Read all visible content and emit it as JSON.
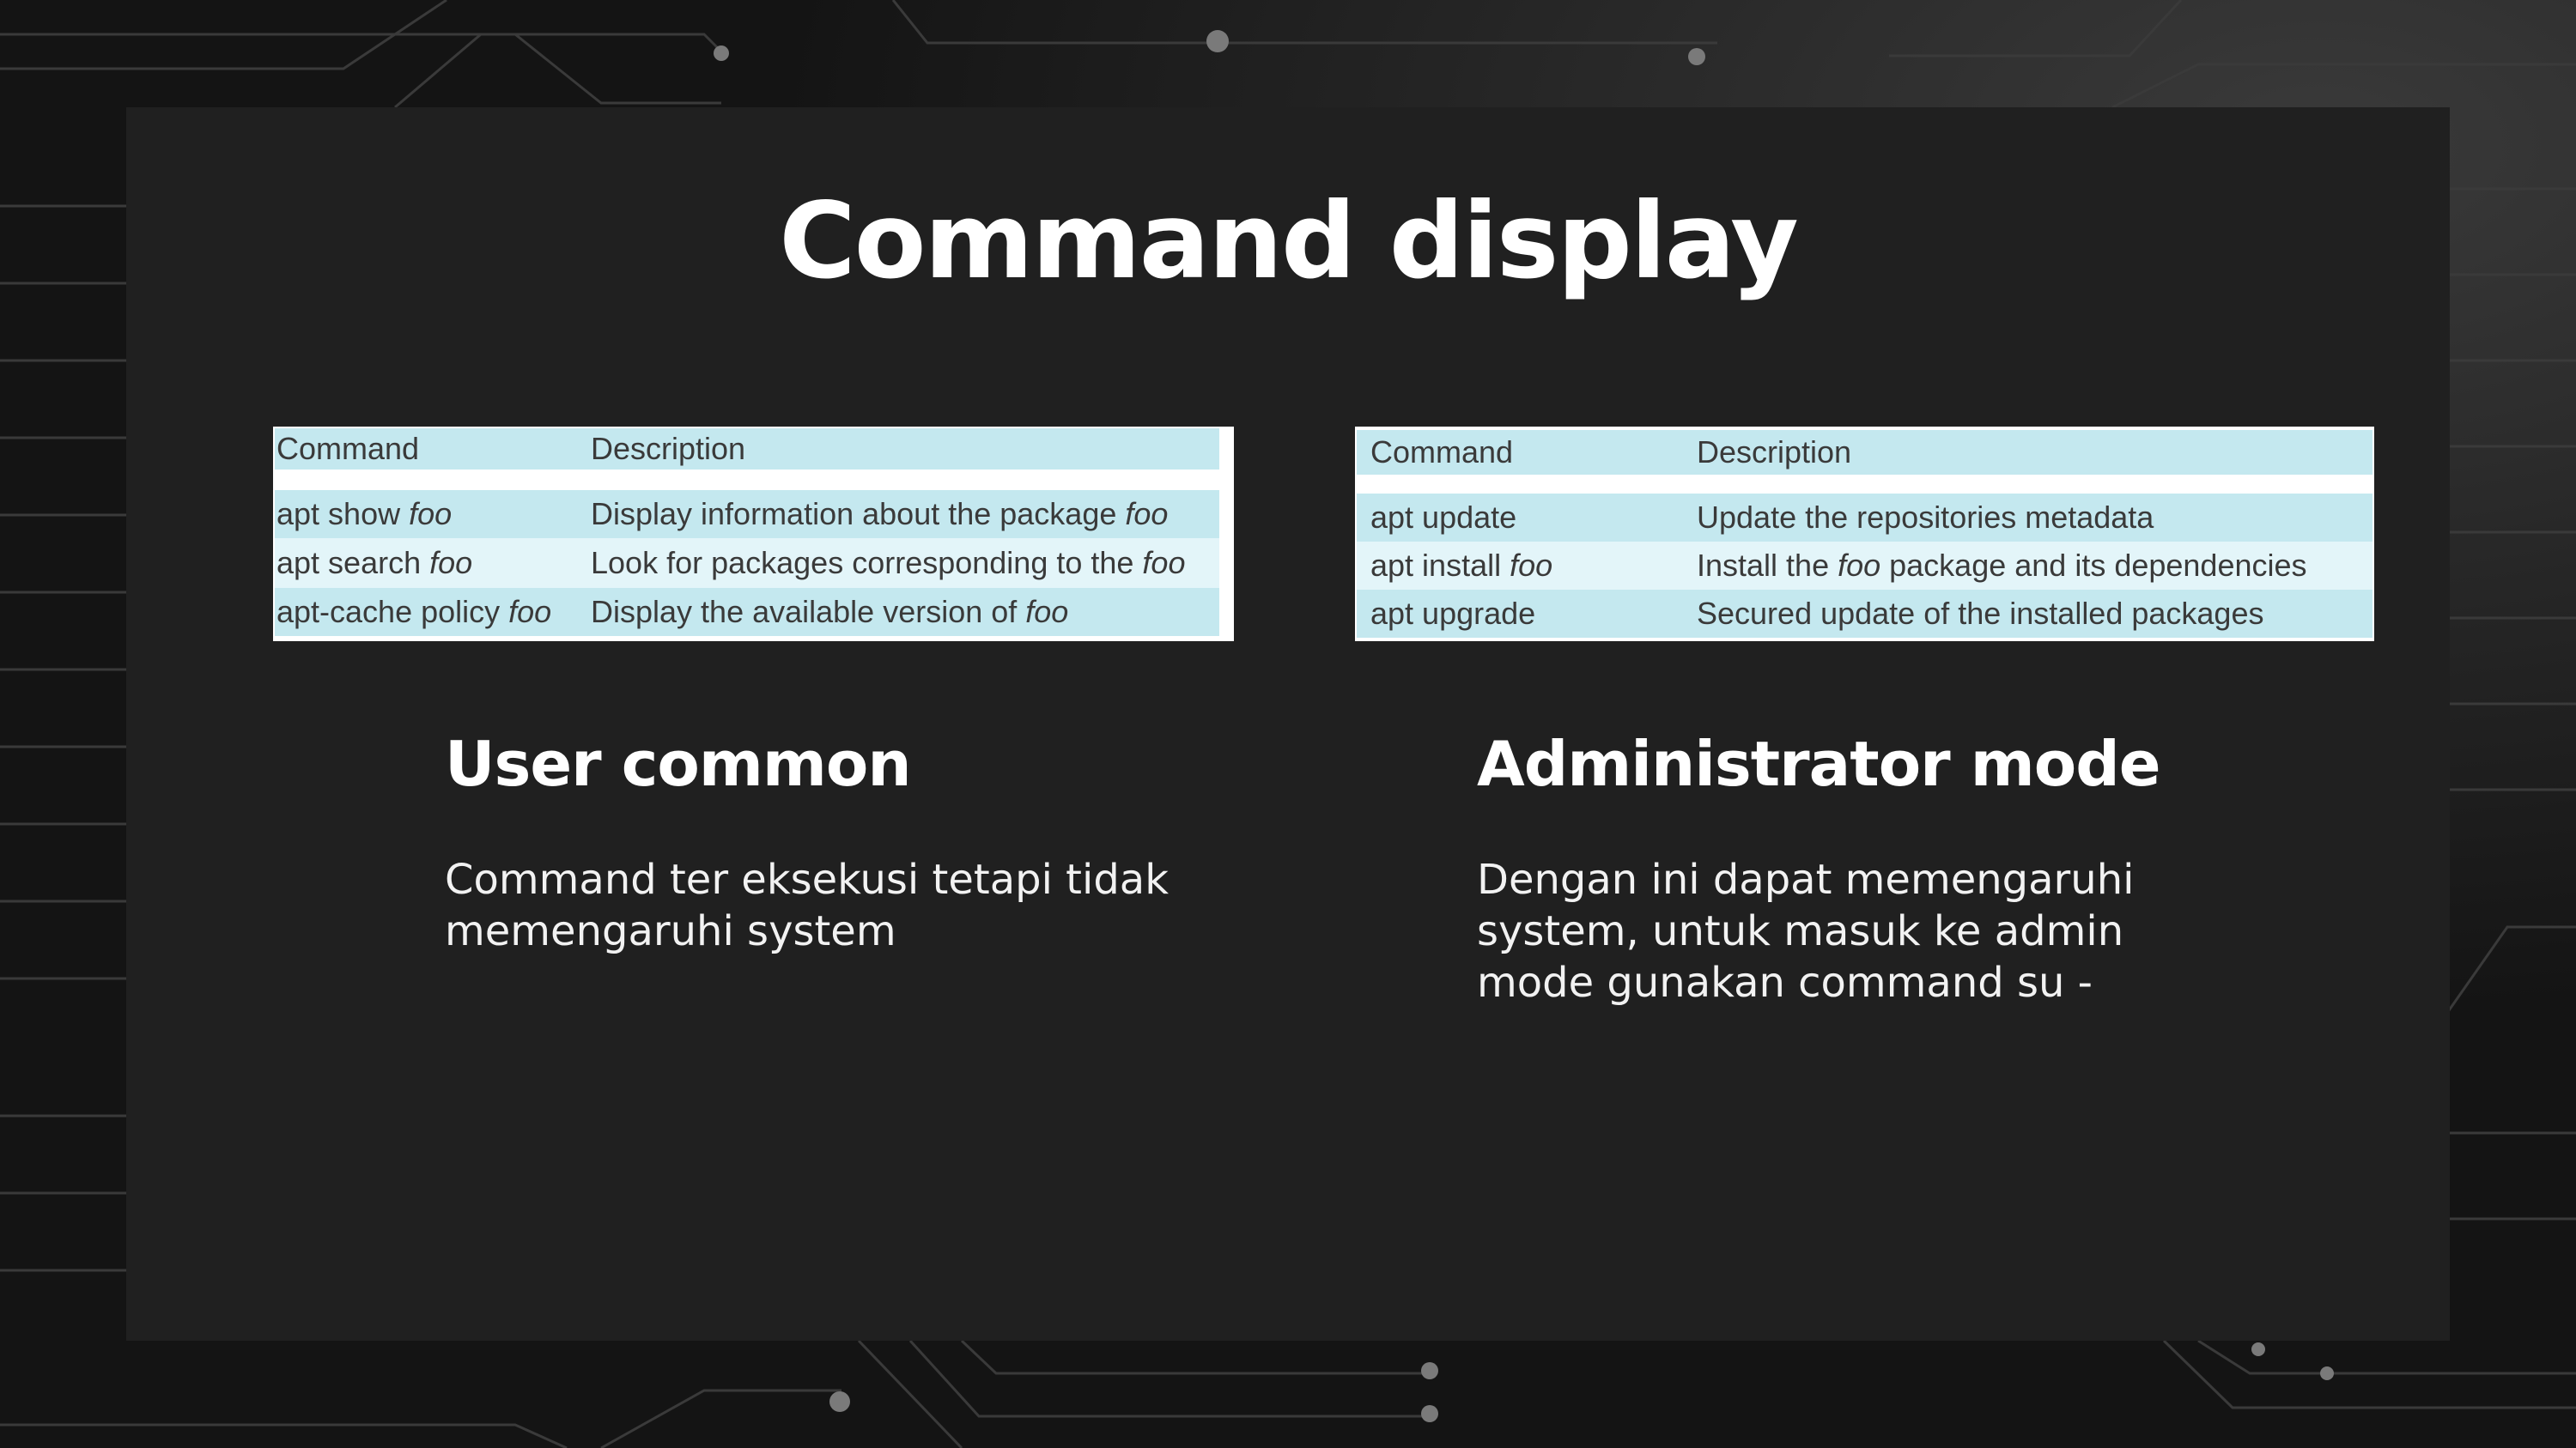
{
  "slide": {
    "title": "Command display"
  },
  "colors": {
    "row_dark": "#c4e8ef",
    "row_light": "#e3f5f9",
    "card": "#202020"
  },
  "user_table": {
    "headers": [
      "Command",
      "Description"
    ],
    "rows": [
      {
        "cmd": "apt show ",
        "cmd_arg": "foo",
        "desc": "Display information about the package ",
        "desc_arg": "foo"
      },
      {
        "cmd": "apt search ",
        "cmd_arg": "foo",
        "desc": "Look for packages corresponding to the ",
        "desc_arg": "foo"
      },
      {
        "cmd": "apt-cache policy ",
        "cmd_arg": "foo",
        "desc": "Display the available version of ",
        "desc_arg": "foo"
      }
    ]
  },
  "admin_table": {
    "headers": [
      "Command",
      "Description"
    ],
    "rows": [
      {
        "cmd": "apt update",
        "desc": "Update the repositories metadata"
      },
      {
        "cmd": "apt install ",
        "cmd_arg": "foo",
        "desc_pre": "Install the ",
        "desc_arg": "foo",
        "desc_post": " package and its dependencies"
      },
      {
        "cmd": "apt upgrade",
        "desc": "Secured update of the installed packages"
      }
    ]
  },
  "user_section": {
    "heading": "User common",
    "lines": [
      "Command ter eksekusi tetapi tidak",
      "memengaruhi system"
    ]
  },
  "admin_section": {
    "heading": "Administrator mode",
    "lines": [
      "Dengan ini dapat memengaruhi",
      "system, untuk masuk ke admin",
      "mode gunakan command su -"
    ]
  }
}
